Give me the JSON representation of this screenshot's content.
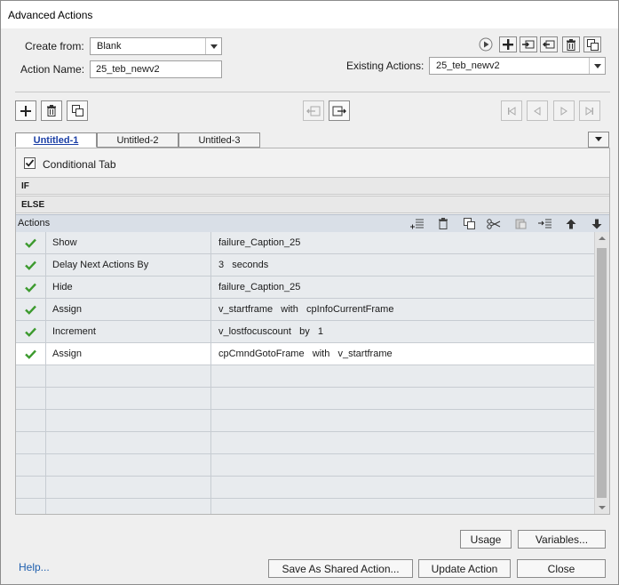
{
  "window": {
    "title": "Advanced Actions"
  },
  "form": {
    "create_from_label": "Create from:",
    "create_from_value": "Blank",
    "action_name_label": "Action Name:",
    "action_name_value": "25_teb_newv2",
    "existing_actions_label": "Existing Actions:",
    "existing_actions_value": "25_teb_newv2"
  },
  "tabs": [
    {
      "label": "Untitled-1",
      "active": true
    },
    {
      "label": "Untitled-2",
      "active": false
    },
    {
      "label": "Untitled-3",
      "active": false
    }
  ],
  "conditional": {
    "label": "Conditional Tab",
    "checked": true
  },
  "sections": {
    "if_label": "IF",
    "else_label": "ELSE",
    "actions_label": "Actions"
  },
  "actions": [
    {
      "status": "ok",
      "action": "Show",
      "target": "failure_Caption_25"
    },
    {
      "status": "ok",
      "action": "Delay Next Actions By",
      "target": "3   seconds"
    },
    {
      "status": "ok",
      "action": "Hide",
      "target": "failure_Caption_25"
    },
    {
      "status": "ok",
      "action": "Assign",
      "target": "v_startframe   with   cpInfoCurrentFrame"
    },
    {
      "status": "ok",
      "action": "Increment",
      "target": "v_lostfocuscount   by   1"
    },
    {
      "status": "ok",
      "action": "Assign",
      "target": "cpCmndGotoFrame   with   v_startframe",
      "selected": true
    }
  ],
  "footer": {
    "usage_label": "Usage",
    "variables_label": "Variables...",
    "help_label": "Help...",
    "save_shared_label": "Save As Shared Action...",
    "update_label": "Update Action",
    "close_label": "Close"
  },
  "colors": {
    "check": "#3c9a2e",
    "link": "#1f5fae",
    "active_tab": "#1b3fa6",
    "selected_row": "#ffffff"
  }
}
